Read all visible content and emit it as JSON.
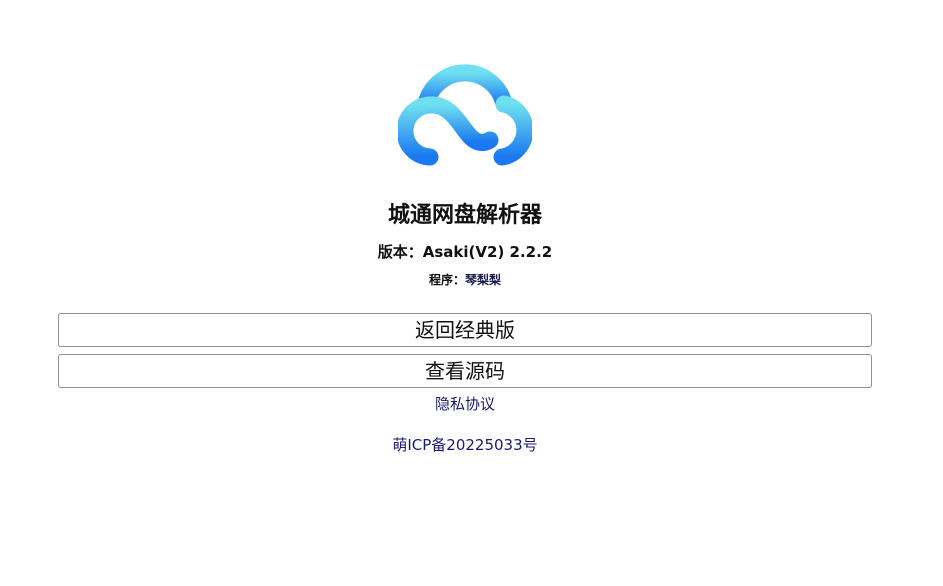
{
  "app": {
    "logo_icon": "cloud-logo-icon",
    "title": "城通网盘解析器"
  },
  "version": {
    "label": "版本：",
    "value": "Asaki(V2) 2.2.2"
  },
  "author": {
    "label": "程序：",
    "name": "琴梨梨"
  },
  "buttons": {
    "classic_label": "返回经典版",
    "source_label": "查看源码"
  },
  "links": {
    "privacy": "隐私协议",
    "icp": "萌ICP备20225033号"
  },
  "colors": {
    "cloud_top": "#6fe0f0",
    "cloud_bottom": "#1a78f0",
    "link": "#1a1a6e"
  }
}
